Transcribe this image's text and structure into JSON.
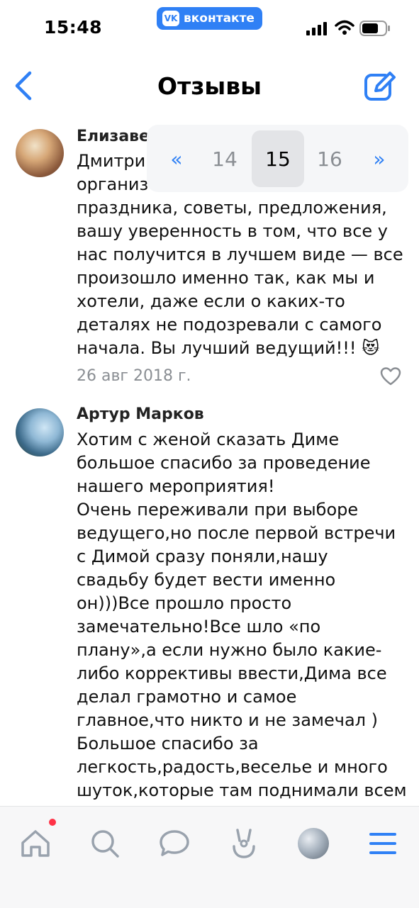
{
  "status_bar": {
    "time": "15:48",
    "app_badge": "вконтакте",
    "icons": [
      "signal-icon",
      "wifi-icon",
      "battery-icon"
    ]
  },
  "nav": {
    "title": "Отзывы",
    "back_icon": "chevron-left-icon",
    "edit_icon": "compose-icon"
  },
  "pager": {
    "first": "«",
    "pages": [
      "14",
      "15",
      "16"
    ],
    "current": "15",
    "last": "»"
  },
  "reviews": [
    {
      "author": "Елизаве",
      "text": "Дмитри\nорганиз\nпраздника, советы, предложения,\nвашу уверенность в том, что все у\nнас получится в лучшем виде — все\nпроизошло именно так, как мы и\nхотели, даже если о каких-то\nдеталях не подозревали с самого\nначала. Вы лучший ведущий!!! 😻",
      "date": "26 авг 2018 г."
    },
    {
      "author": "Артур Марков",
      "text": "Хотим с женой сказать Диме\nбольшое спасибо за проведение\nнашего мероприятия!\nОчень переживали при выборе\nведущего,но после первой встречи\nс Димой сразу поняли,нашу\nсвадьбу будет вести именно\nон)))Все прошло просто\nзамечательно!Все шло «по\nплану»,а если нужно было какие-\nлибо коррективы ввести,Дима все\nделал грамотно и самое\nглавное,что никто и не замечал )\nБольшое спасибо за\nлегкость,радость,веселье и много\nшуток,которые там поднимали всем"
    }
  ],
  "tabbar": {
    "items": [
      "home-icon",
      "search-icon",
      "messages-icon",
      "services-icon",
      "profile-avatar",
      "menu-icon"
    ],
    "accent": "#2f80f5",
    "badge_color": "#ff3347"
  }
}
